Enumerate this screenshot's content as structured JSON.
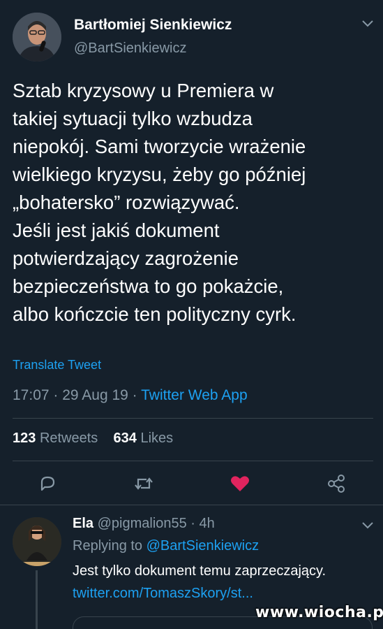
{
  "tweet": {
    "author_name": "Bartłomiej Sienkiewicz",
    "author_handle": "@BartSienkiewicz",
    "text_lines": [
      "Sztab kryzysowy u Premiera w",
      "takiej sytuacji tylko wzbudza",
      "niepokój. Sami tworzycie wrażenie",
      "wielkiego kryzysu, żeby go później",
      "„bohatersko” rozwiązywać.",
      "Jeśli jest jakiś dokument",
      "potwierdzający zagrożenie",
      "bezpieczeństwa to go pokażcie,",
      "albo kończcie ten polityczny cyrk."
    ],
    "translate_label": "Translate Tweet",
    "time": "17:07",
    "date": "29 Aug 19",
    "separator": " · ",
    "app": "Twitter Web App",
    "retweets_count": "123",
    "retweets_label": "Retweets",
    "likes_count": "634",
    "likes_label": "Likes",
    "icons": {
      "reply": "reply-icon",
      "retweet": "retweet-icon",
      "like": "heart-icon",
      "share": "share-icon",
      "menu": "chevron-down-icon"
    },
    "like_color": "#e0245e"
  },
  "reply": {
    "name": "Ela",
    "handle": "@pigmalion55",
    "age": "4h",
    "separator": " · ",
    "replying_prefix": "Replying to ",
    "replying_to": "@BartSienkiewicz",
    "text": "Jest tylko dokument temu zaprzeczający.",
    "link": "twitter.com/TomaszSkory/st..."
  },
  "watermark": "www.wiocha.pl",
  "colors": {
    "background": "#15202b",
    "text": "#ffffff",
    "secondary": "#8899a6",
    "accent": "#1da1f2",
    "divider": "#38444d"
  }
}
